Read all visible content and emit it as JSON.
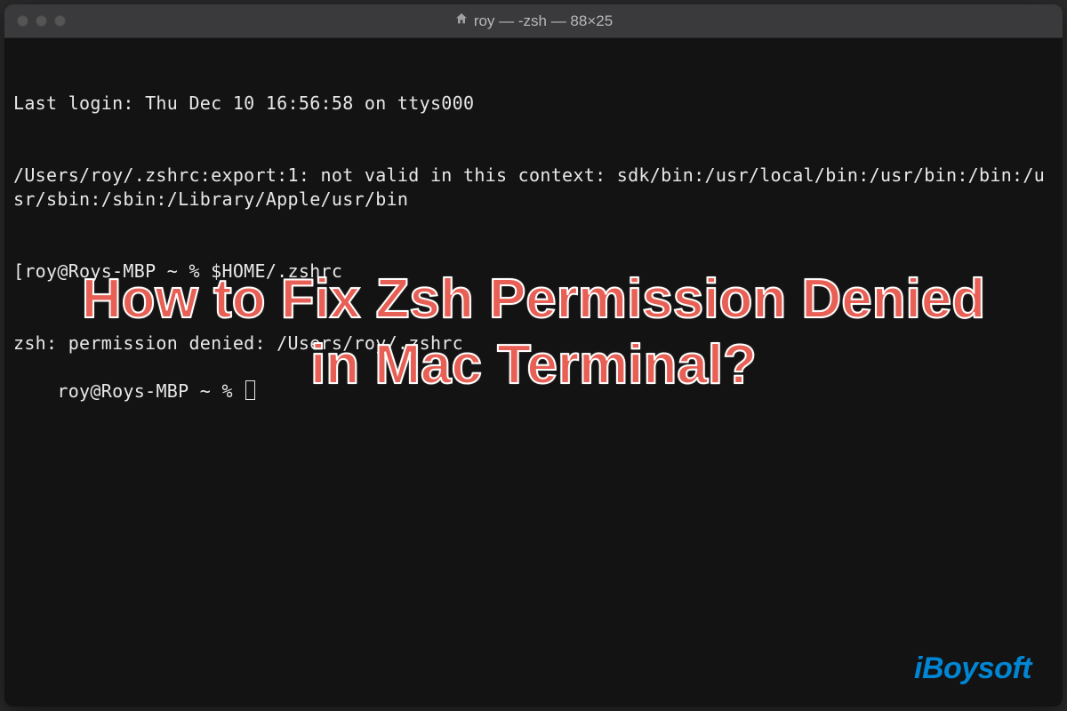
{
  "window": {
    "title": "roy — -zsh — 88×25"
  },
  "terminal": {
    "lines": [
      "Last login: Thu Dec 10 16:56:58 on ttys000",
      "/Users/roy/.zshrc:export:1: not valid in this context: sdk/bin:/usr/local/bin:/usr/bin:/bin:/usr/sbin:/sbin:/Library/Apple/usr/bin",
      "[roy@Roys-MBP ~ % $HOME/.zshrc",
      "zsh: permission denied: /Users/roy/.zshrc",
      "roy@Roys-MBP ~ % "
    ]
  },
  "overlay": {
    "headline": "How to Fix Zsh Permission Denied in Mac Terminal?",
    "watermark": "iBoysoft"
  }
}
